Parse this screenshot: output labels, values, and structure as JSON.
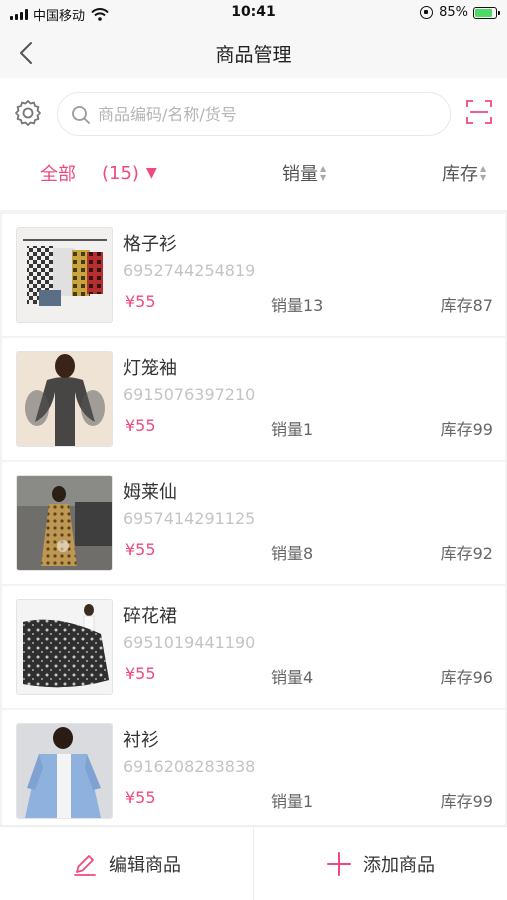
{
  "status_bar": {
    "carrier": "中国移动",
    "time": "10:41",
    "battery": "85%",
    "battery_level": 0.85
  },
  "nav": {
    "title": "商品管理"
  },
  "search": {
    "placeholder": "商品编码/名称/货号"
  },
  "filters": {
    "all_label": "全部",
    "count": "(15)",
    "caret": "▼",
    "sales_label": "销量",
    "stock_label": "库存"
  },
  "products": [
    {
      "name": "格子衫",
      "code": "6952744254819",
      "price": "¥55",
      "sales": "销量13",
      "stock": "库存87"
    },
    {
      "name": "灯笼袖",
      "code": "6915076397210",
      "price": "¥55",
      "sales": "销量1",
      "stock": "库存99"
    },
    {
      "name": "姆莱仙",
      "code": "6957414291125",
      "price": "¥55",
      "sales": "销量8",
      "stock": "库存92"
    },
    {
      "name": "碎花裙",
      "code": "6951019441190",
      "price": "¥55",
      "sales": "销量4",
      "stock": "库存96"
    },
    {
      "name": "衬衫",
      "code": "6916208283838",
      "price": "¥55",
      "sales": "销量1",
      "stock": "库存99"
    }
  ],
  "bottom": {
    "edit_label": "编辑商品",
    "add_label": "添加商品"
  },
  "colors": {
    "accent": "#f04a7c",
    "muted": "#c4c4c4"
  }
}
